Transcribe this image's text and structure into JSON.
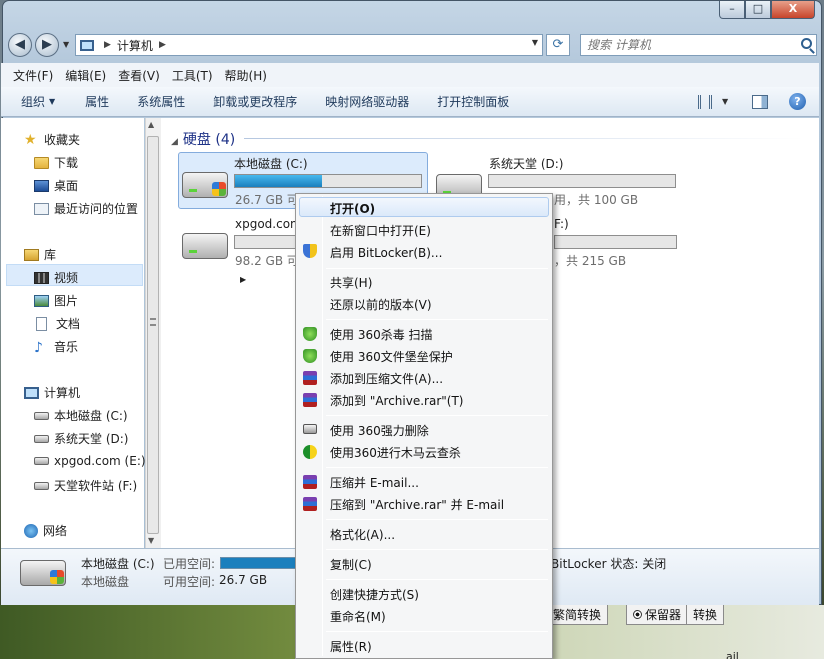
{
  "background": {
    "buttons": [
      "繁简转换",
      "保留器",
      "转换"
    ],
    "corner_text": "ail"
  },
  "window": {
    "caption": {
      "minimize": "–",
      "maximize": "□",
      "close": "X"
    }
  },
  "address_bar": {
    "location": "计算机",
    "search_placeholder": "搜索 计算机"
  },
  "menu": [
    "文件(F)",
    "编辑(E)",
    "查看(V)",
    "工具(T)",
    "帮助(H)"
  ],
  "toolbar": [
    "组织",
    "属性",
    "系统属性",
    "卸载或更改程序",
    "映射网络驱动器",
    "打开控制面板"
  ],
  "nav_pane": {
    "favorites": "收藏夹",
    "favorites_items": [
      "下载",
      "桌面",
      "最近访问的位置"
    ],
    "libraries": "库",
    "library_items": [
      "视频",
      "图片",
      "文档",
      "音乐"
    ],
    "computer": "计算机",
    "computer_items": [
      "本地磁盘 (C:)",
      "系统天堂 (D:)",
      "xpgod.com (E:)",
      "天堂软件站 (F:)"
    ],
    "network": "网络"
  },
  "content": {
    "group_title": "硬盘 (4)",
    "drives": [
      {
        "name": "本地磁盘 (C:)",
        "usage": 0.47,
        "free_text": "26.7 GB 可"
      },
      {
        "name": "系统天堂 (D:)",
        "usage": 0.0,
        "free_text": "用，共 100 GB"
      },
      {
        "name": "xpgod.com",
        "usage": 0.0,
        "free_text": "98.2 GB 可"
      },
      {
        "name": "F:)",
        "usage": 0.0,
        "free_text": "，共 215 GB"
      }
    ]
  },
  "details": {
    "name": "本地磁盘 (C:)",
    "type": "本地磁盘",
    "used_label": "已用空间:",
    "free_label": "可用空间:",
    "free_value": "26.7 GB",
    "bitlocker": "BitLocker 状态: 关闭"
  },
  "context_menu": {
    "items": [
      "打开(O)",
      "在新窗口中打开(E)",
      "启用 BitLocker(B)...",
      "共享(H)",
      "还原以前的版本(V)",
      "使用 360杀毒 扫描",
      "使用 360文件堡垒保护",
      "添加到压缩文件(A)...",
      "添加到 \"Archive.rar\"(T)",
      "使用 360强力删除",
      "使用360进行木马云查杀",
      "压缩并 E-mail...",
      "压缩到 \"Archive.rar\" 并 E-mail",
      "格式化(A)...",
      "复制(C)",
      "创建快捷方式(S)",
      "重命名(M)",
      "属性(R)"
    ]
  }
}
